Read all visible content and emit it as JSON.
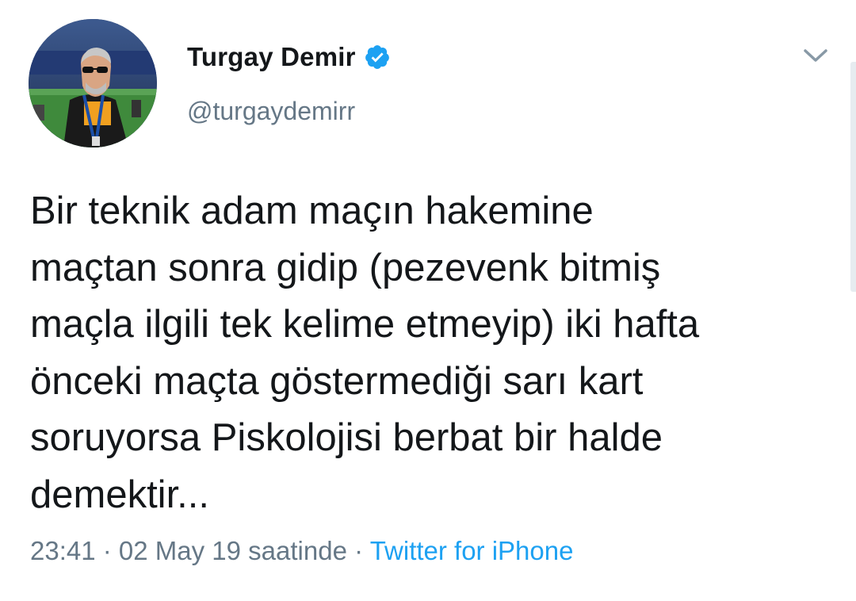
{
  "tweet": {
    "author": {
      "display_name": "Turgay Demir",
      "handle": "@turgaydemirr",
      "verified": true,
      "avatar_icon": "profile-photo"
    },
    "text_lines": [
      "Bir teknik adam maçın hakemine",
      "maçtan sonra gidip (pezevenk bitmiş",
      "maçla ilgili tek kelime etmeyip) iki hafta",
      "önceki maçta göstermediği sarı kart",
      "soruyorsa Piskolojisi berbat bir halde",
      "demektir..."
    ],
    "timestamp": "23:41 · 02 May 19 saatinde",
    "separator": "·",
    "source": "Twitter for iPhone"
  },
  "icons": {
    "verified": "verified-badge-icon",
    "menu": "chevron-down-icon"
  },
  "colors": {
    "text_primary": "#14171a",
    "text_secondary": "#657786",
    "link": "#1da1f2",
    "verified": "#1da1f2",
    "background": "#ffffff"
  }
}
